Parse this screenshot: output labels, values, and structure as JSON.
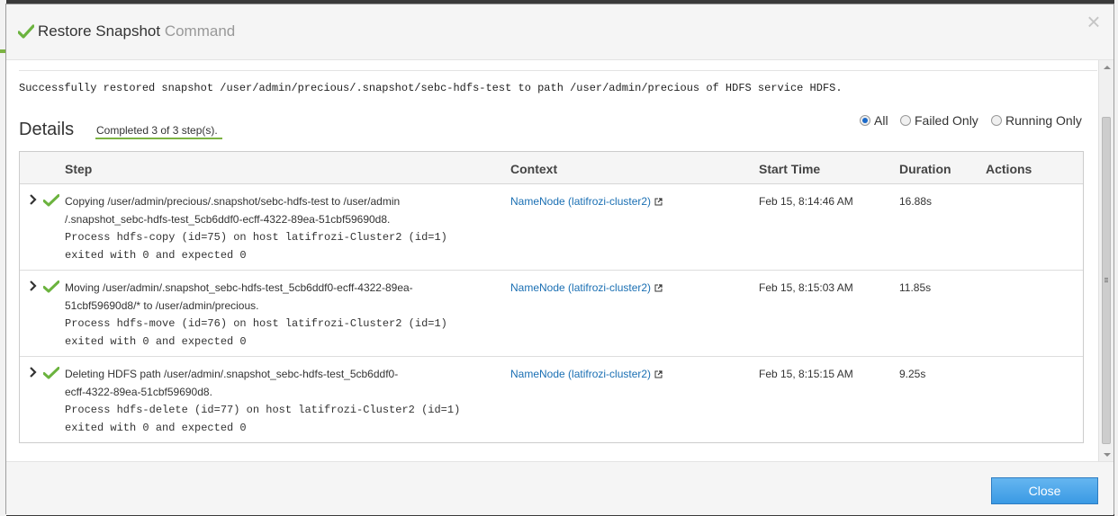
{
  "dialog": {
    "title": "Restore Snapshot",
    "title_suffix": "Command",
    "close_symbol": "×",
    "message": "Successfully restored snapshot /user/admin/precious/.snapshot/sebc-hdfs-test to path /user/admin/precious of HDFS service HDFS."
  },
  "details": {
    "label": "Details",
    "progress": "Completed 3 of 3 step(s).",
    "filters": [
      {
        "label": "All",
        "selected": true
      },
      {
        "label": "Failed Only",
        "selected": false
      },
      {
        "label": "Running Only",
        "selected": false
      }
    ]
  },
  "table": {
    "headers": {
      "step": "Step",
      "context": "Context",
      "start_time": "Start Time",
      "duration": "Duration",
      "actions": "Actions"
    },
    "rows": [
      {
        "status": "success",
        "step_lines": [
          "Copying /user/admin/precious/.snapshot/sebc-hdfs-test to /user/admin",
          "/.snapshot_sebc-hdfs-test_5cb6ddf0-ecff-4322-89ea-51cbf59690d8."
        ],
        "process_line": "Process hdfs-copy (id=75) on host latifrozi-Cluster2 (id=1)",
        "exit_line": "exited with 0 and expected 0",
        "context": "NameNode (latifrozi-cluster2)",
        "start_time": "Feb 15, 8:14:46 AM",
        "duration": "16.88s"
      },
      {
        "status": "success",
        "step_lines": [
          "Moving /user/admin/.snapshot_sebc-hdfs-test_5cb6ddf0-ecff-4322-89ea-",
          "51cbf59690d8/* to /user/admin/precious."
        ],
        "process_line": "Process hdfs-move (id=76) on host latifrozi-Cluster2 (id=1)",
        "exit_line": "exited with 0 and expected 0",
        "context": "NameNode (latifrozi-cluster2)",
        "start_time": "Feb 15, 8:15:03 AM",
        "duration": "11.85s"
      },
      {
        "status": "success",
        "step_lines": [
          "Deleting HDFS path /user/admin/.snapshot_sebc-hdfs-test_5cb6ddf0-",
          "ecff-4322-89ea-51cbf59690d8."
        ],
        "process_line": "Process hdfs-delete (id=77) on host latifrozi-Cluster2 (id=1)",
        "exit_line": "exited with 0 and expected 0",
        "context": "NameNode (latifrozi-cluster2)",
        "start_time": "Feb 15, 8:15:15 AM",
        "duration": "9.25s"
      }
    ]
  },
  "footer": {
    "close_label": "Close"
  },
  "colors": {
    "success_green": "#6bb33e",
    "link_blue": "#1a6fb3",
    "primary_button": "#3a9ae4",
    "progress_underline": "#7cb342"
  },
  "icons": {
    "header_status": "check-icon",
    "row_status": "check-icon",
    "expander": "chevron-right-icon",
    "external_link": "external-link-icon",
    "close": "close-icon"
  }
}
